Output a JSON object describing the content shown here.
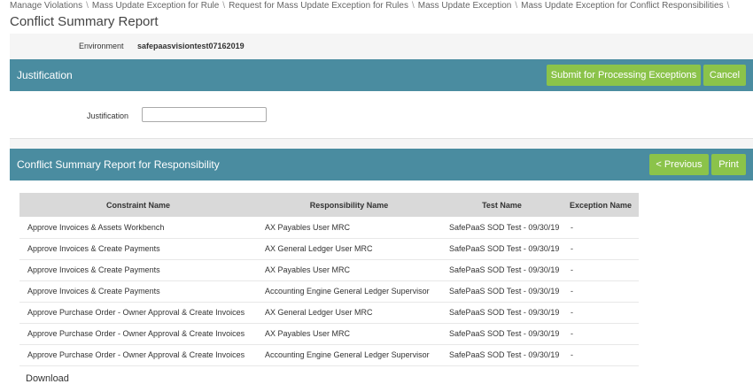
{
  "breadcrumb": [
    "Manage Violations",
    "Mass Update Exception for Rule",
    "Request for Mass Update Exception for Rules",
    "Mass Update Exception",
    "Mass Update Exception for Conflict Responsibilities"
  ],
  "breadcrumb_separator": "\\",
  "page_title": "Conflict Summary Report",
  "environment": {
    "label": "Environment",
    "value": "safepaasvisiontest07162019"
  },
  "justification_panel": {
    "title": "Justification",
    "submit_label": "Submit for Processing Exceptions",
    "cancel_label": "Cancel",
    "field_label": "Justification",
    "field_value": ""
  },
  "report_panel": {
    "title": "Conflict Summary Report for Responsibility",
    "previous_label": "< Previous",
    "print_label": "Print"
  },
  "table": {
    "columns": [
      "Constraint Name",
      "Responsibility Name",
      "Test Name",
      "Exception Name"
    ],
    "rows": [
      [
        "Approve Invoices & Assets Workbench",
        "AX Payables User MRC",
        "SafePaaS SOD Test - 09/30/19",
        "-"
      ],
      [
        "Approve Invoices & Create Payments",
        "AX General Ledger User MRC",
        "SafePaaS SOD Test - 09/30/19",
        "-"
      ],
      [
        "Approve Invoices & Create Payments",
        "AX Payables User MRC",
        "SafePaaS SOD Test - 09/30/19",
        "-"
      ],
      [
        "Approve Invoices & Create Payments",
        "Accounting Engine General Ledger Supervisor",
        "SafePaaS SOD Test - 09/30/19",
        "-"
      ],
      [
        "Approve Purchase Order - Owner Approval & Create Invoices",
        "AX General Ledger User MRC",
        "SafePaaS SOD Test - 09/30/19",
        "-"
      ],
      [
        "Approve Purchase Order - Owner Approval & Create Invoices",
        "AX Payables User MRC",
        "SafePaaS SOD Test - 09/30/19",
        "-"
      ],
      [
        "Approve Purchase Order - Owner Approval & Create Invoices",
        "Accounting Engine General Ledger Supervisor",
        "SafePaaS SOD Test - 09/30/19",
        "-"
      ]
    ]
  },
  "download_label": "Download",
  "colors": {
    "panel_header": "#4a8ca0",
    "button_green": "#8bc34a",
    "table_header": "#d9d9d9"
  }
}
